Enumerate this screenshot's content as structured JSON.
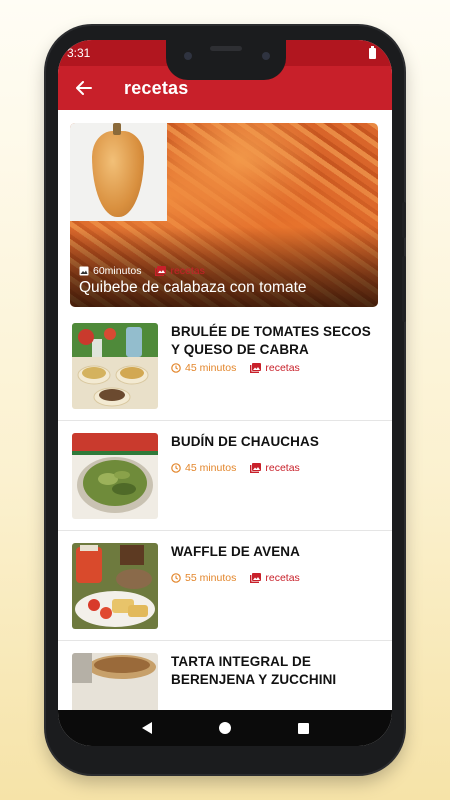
{
  "status": {
    "time": "3:31"
  },
  "appbar": {
    "title": "recetas"
  },
  "featured": {
    "time": "60minutos",
    "category": "recetas",
    "title": "Quibebe de calabaza con tomate"
  },
  "recipes": [
    {
      "title": "BRULÉE DE TOMATES SECOS Y QUESO DE CABRA",
      "time": "45 minutos",
      "category": "recetas"
    },
    {
      "title": "BUDÍN DE CHAUCHAS",
      "time": "45 minutos",
      "category": "recetas"
    },
    {
      "title": "WAFFLE DE AVENA",
      "time": "55 minutos",
      "category": "recetas"
    },
    {
      "title": "TARTA INTEGRAL DE BERENJENA Y ZUCCHINI",
      "time": "",
      "category": ""
    }
  ],
  "colors": {
    "appbar": "#c8202a",
    "statusbar": "#b1161f",
    "time": "#e3862b",
    "category": "#c8202a"
  }
}
